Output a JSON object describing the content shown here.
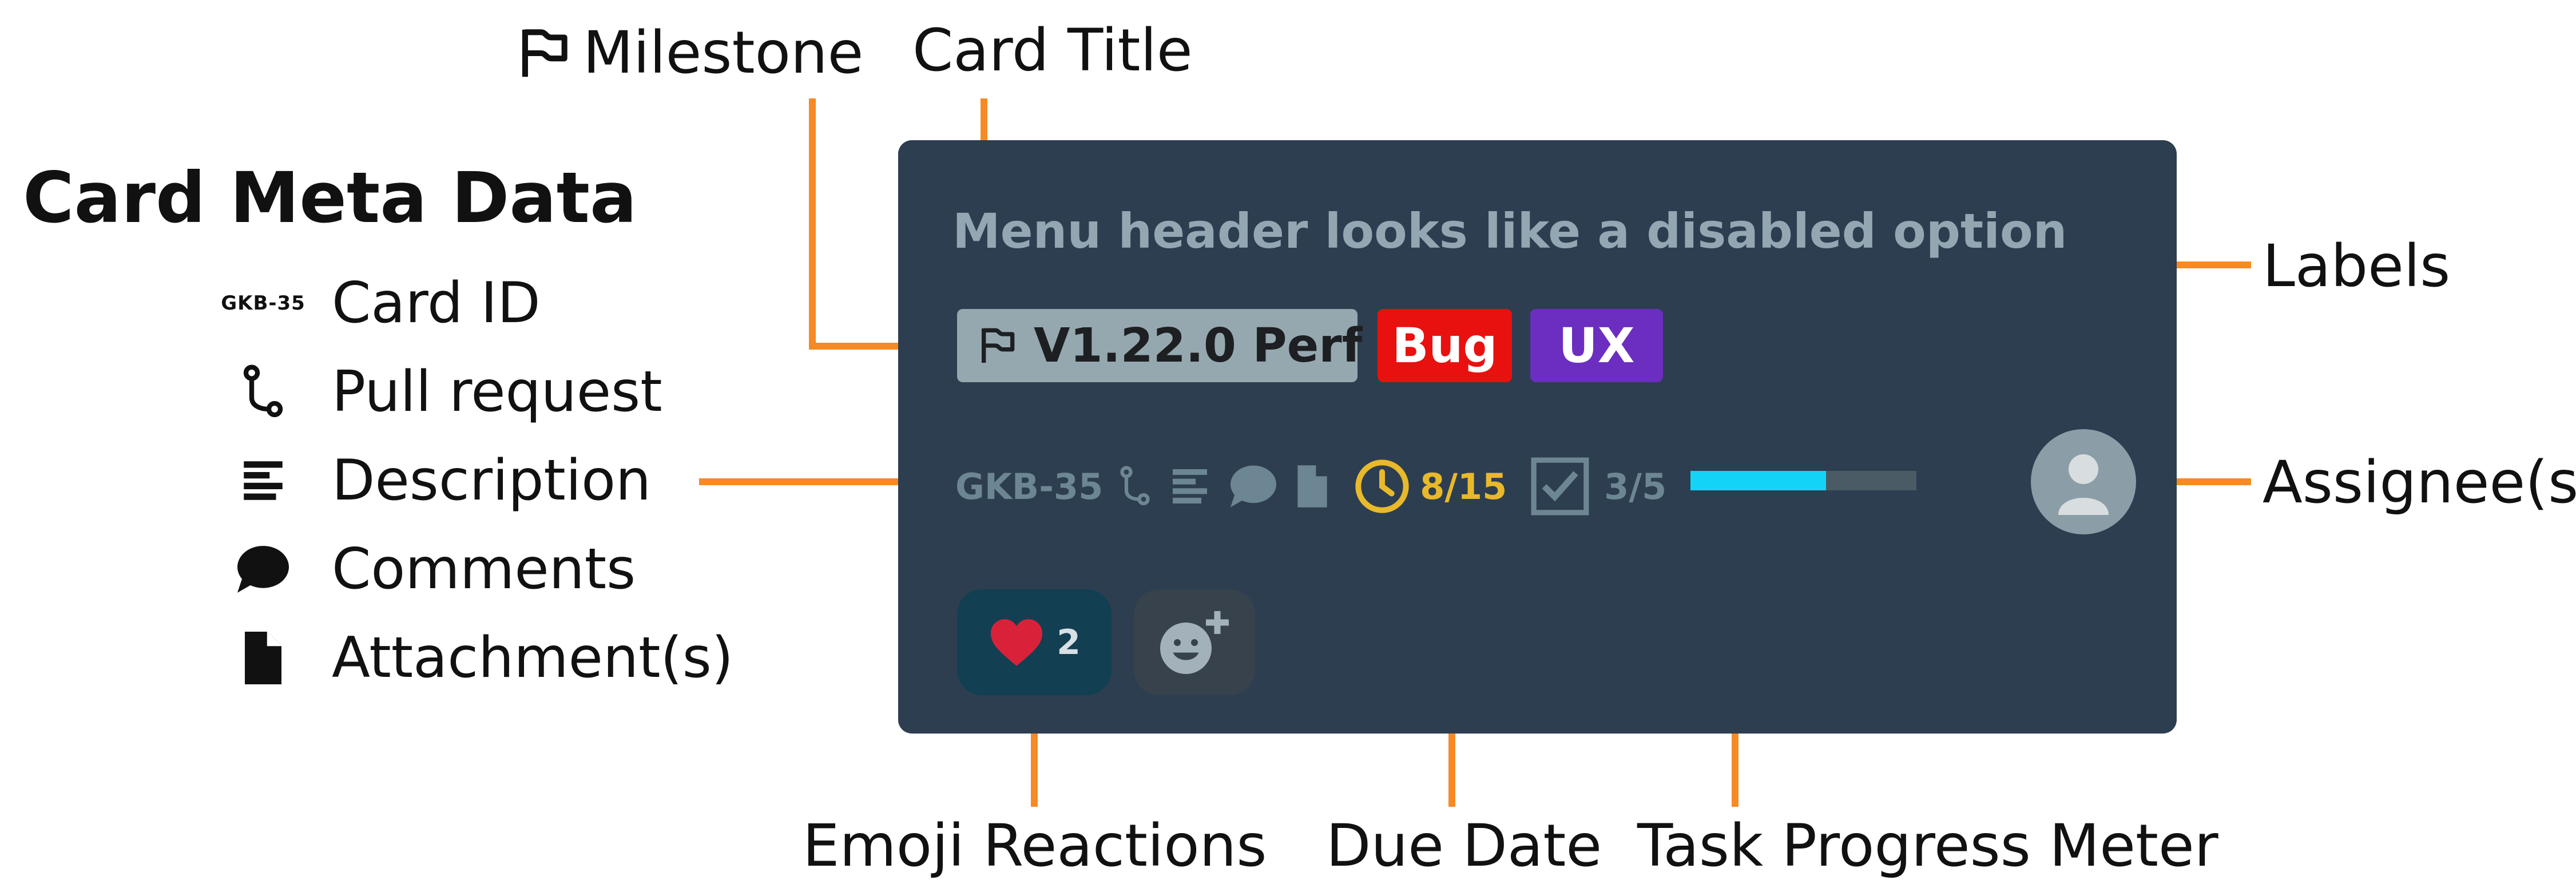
{
  "annotations": {
    "milestone": "Milestone",
    "card_title": "Card Title",
    "labels": "Labels",
    "assignees": "Assignee(s)",
    "emoji_reactions": "Emoji Reactions",
    "due_date": "Due Date",
    "task_progress_meter": "Task Progress Meter"
  },
  "legend": {
    "title": "Card Meta Data",
    "items": [
      {
        "icon_text": "GKB-35",
        "label": "Card ID"
      },
      {
        "icon": "pull-request-icon",
        "label": "Pull request"
      },
      {
        "icon": "description-icon",
        "label": "Description"
      },
      {
        "icon": "comment-icon",
        "label": "Comments"
      },
      {
        "icon": "attachment-icon",
        "label": "Attachment(s)"
      }
    ]
  },
  "card": {
    "title": "Menu header looks like a disabled option",
    "milestone": "V1.22.0 Perf",
    "labels": [
      {
        "text": "Bug",
        "color": "#e8110f"
      },
      {
        "text": "UX",
        "color": "#6b2ec0"
      }
    ],
    "card_id": "GKB-35",
    "due_date": "8/15",
    "tasks": {
      "text": "3/5",
      "completed": 3,
      "total": 5,
      "fill_color": "#13d4f5"
    },
    "reactions": [
      {
        "emoji": "heart-icon",
        "count": "2"
      }
    ],
    "background": "#2d3e50"
  }
}
